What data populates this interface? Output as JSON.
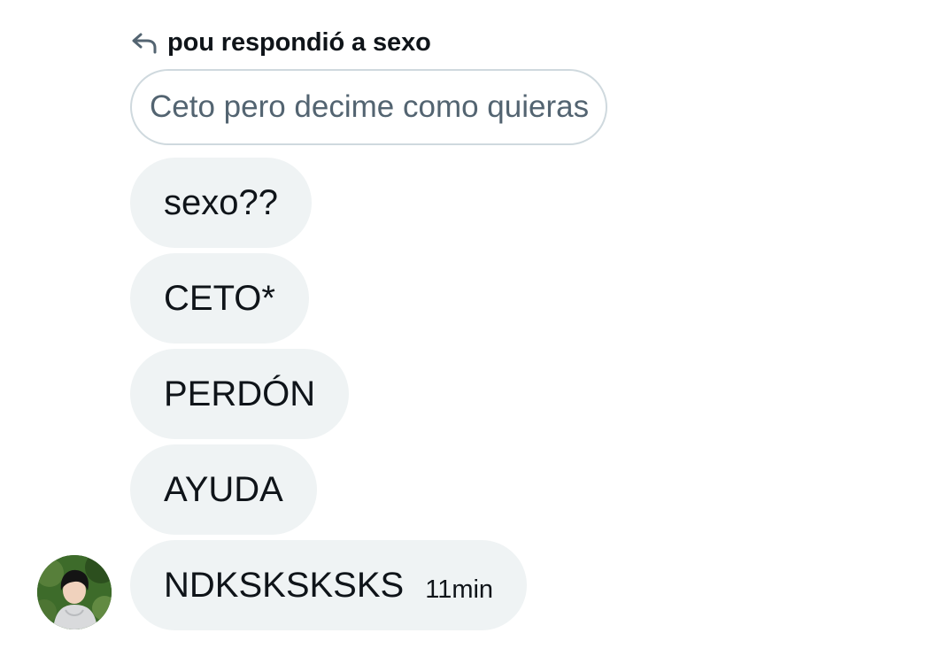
{
  "reply": {
    "icon": "reply-arrow-icon",
    "label": "pou respondió a sexo",
    "quoted": "Ceto pero decime como quieras"
  },
  "messages": [
    {
      "text": "sexo??"
    },
    {
      "text": "CETO*"
    },
    {
      "text": "PERDÓN"
    },
    {
      "text": "AYUDA"
    },
    {
      "text": "NDKSKSKSKS",
      "time": "11min"
    }
  ],
  "avatar": {
    "icon": "user-avatar"
  },
  "colors": {
    "bubble_bg": "#eff3f4",
    "border": "#cfd9de",
    "text": "#0f1419",
    "muted_text": "#536471"
  }
}
